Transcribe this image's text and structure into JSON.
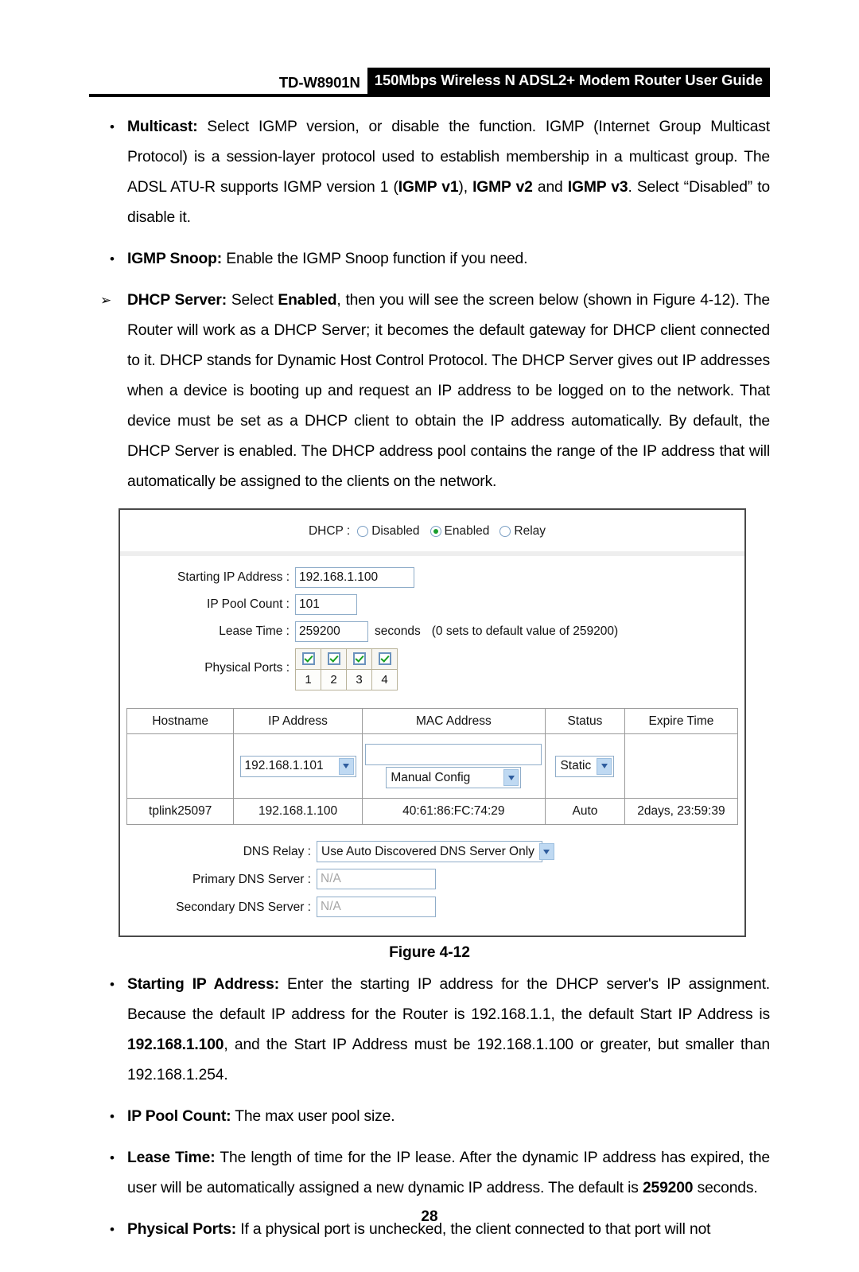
{
  "header": {
    "model": "TD-W8901N",
    "title": "150Mbps Wireless N ADSL2+ Modem Router User Guide"
  },
  "body_items": [
    {
      "bullet": "dot",
      "label": "Multicast:",
      "text_1": " Select IGMP version, or disable the function. IGMP (Internet Group Multicast Protocol) is a session-layer protocol used to establish membership in a multicast group. The ADSL ATU-R supports IGMP version 1 (",
      "bold_1": "IGMP v1",
      "text_2": "), ",
      "bold_2": "IGMP v2",
      "text_3": " and ",
      "bold_3": "IGMP v3",
      "text_4": ". Select “Disabled” to disable it."
    },
    {
      "bullet": "dot",
      "label": "IGMP Snoop:",
      "text_1": " Enable the IGMP Snoop function if you need."
    },
    {
      "bullet": "arrow",
      "label": "DHCP Server:",
      "text_1": " Select ",
      "bold_1": "Enabled",
      "text_2": ", then you will see the screen below (shown in Figure 4-12). The Router will work as a DHCP Server; it becomes the default gateway for DHCP client connected to it. DHCP stands for Dynamic Host Control Protocol. The DHCP Server gives out IP addresses when a device is booting up and request an IP address to be logged on to the network. That device must be set as a DHCP client to obtain the IP address automatically. By default, the DHCP Server is enabled. The DHCP address pool contains the range of the IP address that will automatically be assigned to the clients on the network."
    }
  ],
  "figure": {
    "caption": "Figure 4-12",
    "dhcp": {
      "label": "DHCP :",
      "options": [
        {
          "label": "Disabled",
          "selected": false
        },
        {
          "label": "Enabled",
          "selected": true
        },
        {
          "label": "Relay",
          "selected": false
        }
      ]
    },
    "form": {
      "starting_ip_label": "Starting IP Address :",
      "starting_ip_value": "192.168.1.100",
      "pool_count_label": "IP Pool Count :",
      "pool_count_value": "101",
      "lease_time_label": "Lease Time :",
      "lease_time_value": "259200",
      "lease_units": "seconds",
      "lease_hint": "(0 sets to default value of 259200)",
      "physical_ports_label": "Physical Ports :",
      "ports": [
        {
          "number": "1",
          "checked": true
        },
        {
          "number": "2",
          "checked": true
        },
        {
          "number": "3",
          "checked": true
        },
        {
          "number": "4",
          "checked": true
        }
      ]
    },
    "client_table": {
      "columns": [
        "Hostname",
        "IP Address",
        "MAC Address",
        "Status",
        "Expire Time"
      ],
      "edit_row": {
        "hostname": "",
        "ip_select": "192.168.1.101",
        "mac_input": "",
        "mac_select": "Manual Config",
        "status_select": "Static",
        "expire": ""
      },
      "rows": [
        {
          "hostname": "tplink25097",
          "ip": "192.168.1.100",
          "mac": "40:61:86:FC:74:29",
          "status": "Auto",
          "expire": "2days, 23:59:39"
        }
      ]
    },
    "dns": {
      "relay_label": "DNS Relay :",
      "relay_value": "Use Auto Discovered DNS Server Only",
      "primary_label": "Primary DNS Server :",
      "primary_value": "N/A",
      "secondary_label": "Secondary DNS Server :",
      "secondary_value": "N/A"
    }
  },
  "after_items": [
    {
      "bullet": "dot",
      "label": "Starting IP Address:",
      "text_1": " Enter the starting IP address for the DHCP server's IP assignment. Because the default IP address for the Router is 192.168.1.1, the default Start IP Address is ",
      "bold_1": "192.168.1.100",
      "text_2": ", and the Start IP Address must be 192.168.1.100 or greater, but smaller than 192.168.1.254."
    },
    {
      "bullet": "dot",
      "label": "IP Pool Count:",
      "text_1": " The max user pool size."
    },
    {
      "bullet": "dot",
      "label": "Lease Time:",
      "text_1": " The length of time for the IP lease. After the dynamic IP address has expired, the user will be automatically assigned a new dynamic IP address. The default is ",
      "bold_1": "259200",
      "text_2": " seconds."
    },
    {
      "bullet": "dot",
      "label": "Physical Ports:",
      "text_1": " If a physical port is unchecked, the client connected to that port will not"
    }
  ],
  "page_number": "28",
  "colors": {
    "banner_bg": "#000000",
    "input_border": "#8fadc9",
    "radio_selected": "#1a9e2e",
    "check_green": "#17a01f",
    "dropdown_btn": "#bfd9f2"
  }
}
